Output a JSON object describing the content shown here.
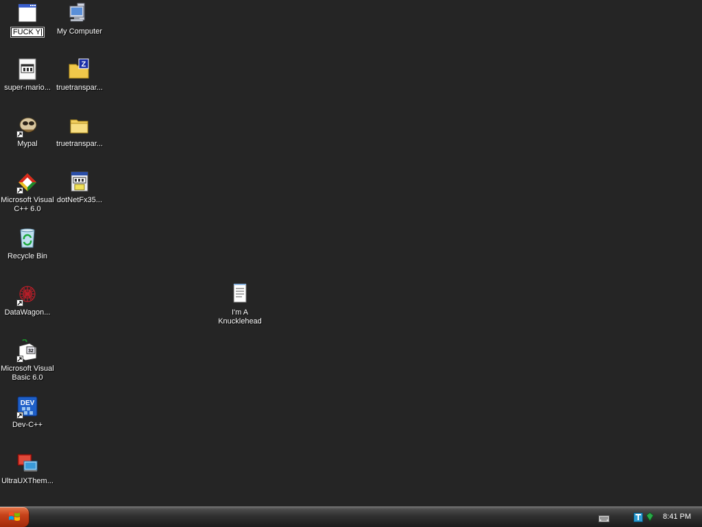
{
  "desktop": {
    "rename_text": "FUCK Y",
    "icons": {
      "my_computer": "My Computer",
      "super_mario": "super-mario...",
      "truetransparency_zip": "truetranspar...",
      "mypal": "Mypal",
      "truetransparency_folder": "truetranspar...",
      "msvc_line1": "Microsoft Visual",
      "msvc_line2": "C++ 6.0",
      "dotnet": "dotNetFx35...",
      "recycle_bin": "Recycle Bin",
      "datawagon": "DataWagon...",
      "knucklehead_line1": "I'm A",
      "knucklehead_line2": "Knucklehead",
      "msvb_line1": "Microsoft Visual",
      "msvb_line2": "Basic 6.0",
      "devcpp": "Dev-C++",
      "ultraux": "UltraUXThem..."
    }
  },
  "taskbar": {
    "clock": "8:41 PM"
  },
  "colors": {
    "desktop_bg": "#252525",
    "start_button": "#c6421a"
  },
  "icon_names": [
    "window-icon",
    "my-computer-icon",
    "executable-icon",
    "zip-folder-icon",
    "mypal-icon",
    "folder-icon",
    "msvc-icon",
    "installer-icon",
    "recycle-bin-icon",
    "datawagon-icon",
    "notepad-icon",
    "msvb-icon",
    "devcpp-icon",
    "ultraux-icon",
    "keyboard-icon",
    "network-icon"
  ]
}
